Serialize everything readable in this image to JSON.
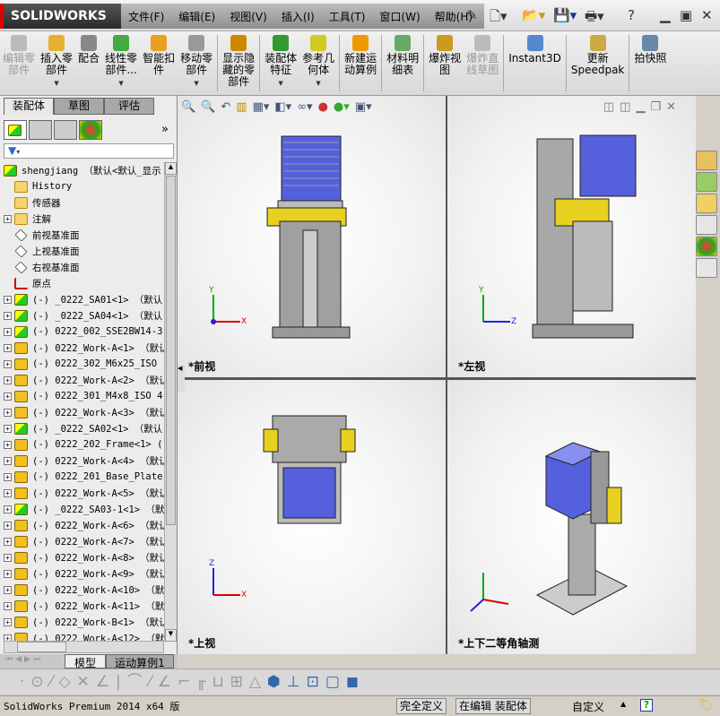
{
  "app": {
    "logo": "SOLIDWORKS",
    "brand_color": "#d40000"
  },
  "menu": [
    "文件(F)",
    "编辑(E)",
    "视图(V)",
    "插入(I)",
    "工具(T)",
    "窗口(W)",
    "帮助(H)"
  ],
  "quick_access": {
    "new": "new-document-icon",
    "open": "open-icon",
    "save": "save-icon",
    "print": "print-icon",
    "help": "?"
  },
  "commands": [
    {
      "label": "编辑零\n部件",
      "disabled": true,
      "color": "#bbb"
    },
    {
      "label": "插入零\n部件",
      "arrow": true,
      "color": "#e8b030"
    },
    {
      "label": "配合",
      "color": "#888"
    },
    {
      "label": "线性零\n部件...",
      "arrow": true,
      "color": "#4a4"
    },
    {
      "label": "智能扣\n件",
      "color": "#e8a020"
    },
    {
      "label": "移动零\n部件",
      "arrow": true,
      "color": "#999"
    },
    {
      "label": "显示隐\n藏的零\n部件",
      "color": "#c80"
    },
    {
      "label": "装配体\n特征",
      "arrow": true,
      "color": "#393"
    },
    {
      "label": "参考几\n何体",
      "arrow": true,
      "color": "#cc2"
    },
    {
      "label": "新建运\n动算例",
      "color": "#e90"
    },
    {
      "label": "材料明\n细表",
      "color": "#6a6"
    },
    {
      "label": "爆炸视\n图",
      "color": "#c92"
    },
    {
      "label": "爆炸直\n线草图",
      "disabled": true,
      "color": "#bbb"
    },
    {
      "label": "Instant3D",
      "color": "#58c"
    },
    {
      "label": "更新\nSpeedpak",
      "color": "#ca4"
    },
    {
      "label": "拍快照",
      "color": "#68a"
    }
  ],
  "left_tabs": [
    "装配体",
    "草图",
    "评估"
  ],
  "tree": {
    "root": "shengjiang （默认<默认_显示",
    "items": [
      {
        "label": "History",
        "icon": "history",
        "expand": false
      },
      {
        "label": "传感器",
        "icon": "sensor",
        "expand": false
      },
      {
        "label": "注解",
        "icon": "annotation",
        "expand": true
      },
      {
        "label": "前视基准面",
        "icon": "plane",
        "expand": false
      },
      {
        "label": "上视基准面",
        "icon": "plane",
        "expand": false
      },
      {
        "label": "右视基准面",
        "icon": "plane",
        "expand": false
      },
      {
        "label": "原点",
        "icon": "origin",
        "expand": false
      },
      {
        "label": "(-) _0222_SA01<1> （默认",
        "icon": "asm",
        "expand": true
      },
      {
        "label": "(-) _0222_SA04<1> （默认",
        "icon": "asm",
        "expand": true
      },
      {
        "label": "(-) 0222_002_SSE2BW14-3",
        "icon": "asm",
        "expand": true
      },
      {
        "label": "(-) 0222_Work-A<1> （默认",
        "icon": "part",
        "expand": true
      },
      {
        "label": "(-) 0222_302_M6x25_ISO",
        "icon": "part",
        "expand": true
      },
      {
        "label": "(-) 0222_Work-A<2> （默认",
        "icon": "part",
        "expand": true
      },
      {
        "label": "(-) 0222_301_M4x8_ISO 4",
        "icon": "part",
        "expand": true
      },
      {
        "label": "(-) 0222_Work-A<3> （默认",
        "icon": "part",
        "expand": true
      },
      {
        "label": "(-) _0222_SA02<1> （默认",
        "icon": "asm",
        "expand": true
      },
      {
        "label": "(-) 0222_202_Frame<1> (",
        "icon": "part",
        "expand": true
      },
      {
        "label": "(-) 0222_Work-A<4> （默认",
        "icon": "part",
        "expand": true
      },
      {
        "label": "(-) 0222_201_Base_Plate",
        "icon": "part",
        "expand": true
      },
      {
        "label": "(-) 0222_Work-A<5> （默认",
        "icon": "part",
        "expand": true
      },
      {
        "label": "(-) _0222_SA03-1<1> （默",
        "icon": "asm",
        "expand": true
      },
      {
        "label": "(-) 0222_Work-A<6> （默认",
        "icon": "part",
        "expand": true
      },
      {
        "label": "(-) 0222_Work-A<7> （默认",
        "icon": "part",
        "expand": true
      },
      {
        "label": "(-) 0222_Work-A<8> （默认",
        "icon": "part",
        "expand": true
      },
      {
        "label": "(-) 0222_Work-A<9> （默认",
        "icon": "part",
        "expand": true
      },
      {
        "label": "(-) 0222_Work-A<10> （默",
        "icon": "part",
        "expand": true
      },
      {
        "label": "(-) 0222_Work-A<11> （默",
        "icon": "part",
        "expand": true
      },
      {
        "label": "(-) 0222_Work-B<1> （默认",
        "icon": "part",
        "expand": true
      },
      {
        "label": "(-) 0222_Work-A<12> （默",
        "icon": "part",
        "expand": true
      }
    ]
  },
  "bottom_tabs": [
    "模型",
    "运动算例1"
  ],
  "views": [
    {
      "label": "*前视"
    },
    {
      "label": "*左视"
    },
    {
      "label": "*上视"
    },
    {
      "label": "*上下二等角轴测"
    }
  ],
  "axes": {
    "x": "X",
    "y": "Y",
    "z": "Z"
  },
  "status": {
    "product": "SolidWorks Premium 2014 x64 版",
    "state": "完全定义",
    "mode": "在编辑 装配体",
    "units": "自定义"
  }
}
